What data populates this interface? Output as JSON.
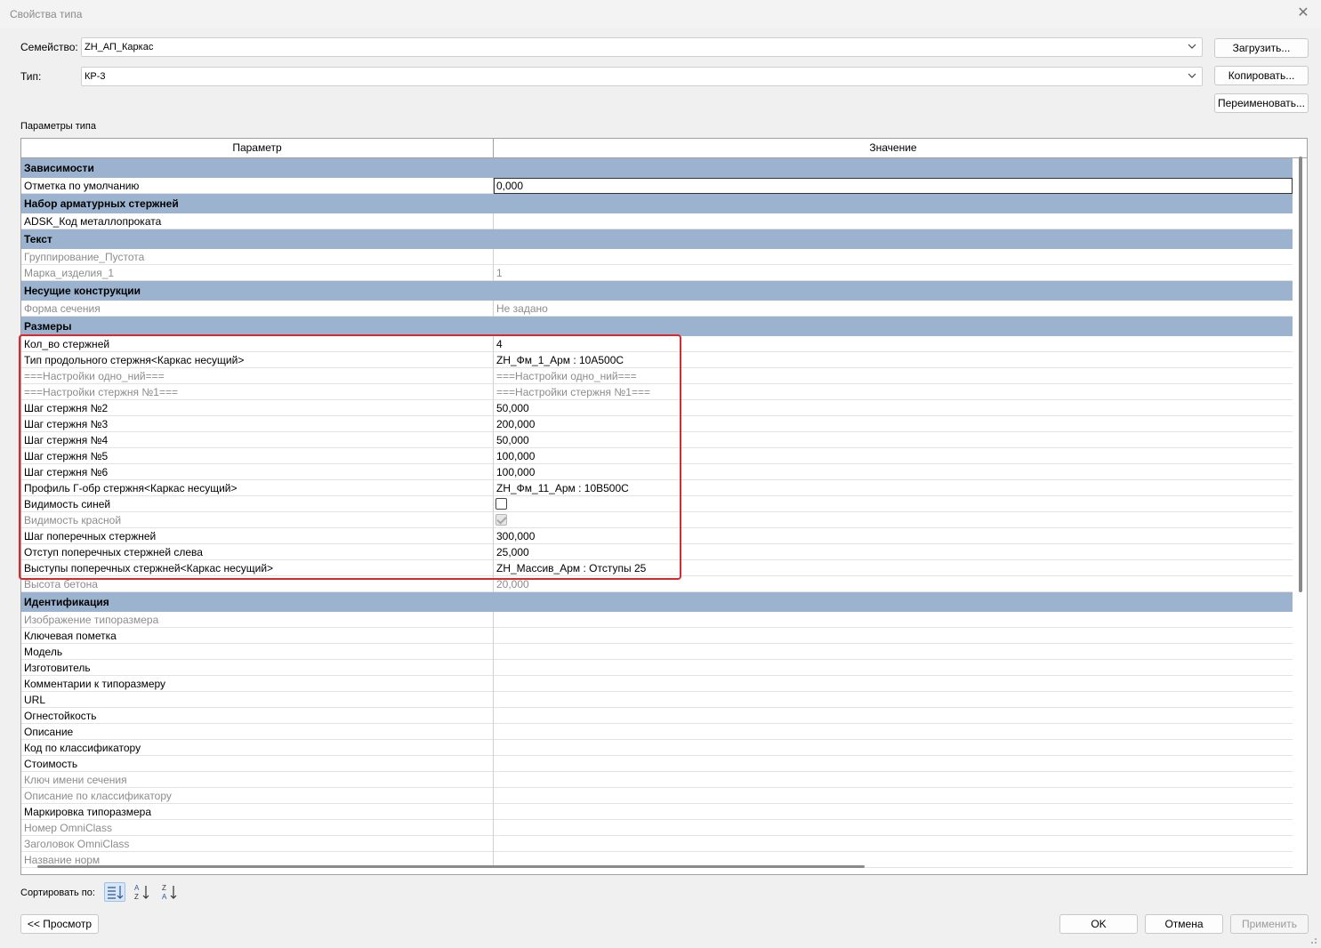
{
  "window": {
    "title": "Свойства типа"
  },
  "family": {
    "label": "Семейство:",
    "value": "ZH_АП_Каркас"
  },
  "type": {
    "label": "Тип:",
    "value": "КР-3"
  },
  "buttons": {
    "load": "Загрузить...",
    "copy": "Копировать...",
    "rename": "Переименовать...",
    "preview": "<< Просмотр",
    "ok": "OK",
    "cancel": "Отмена",
    "apply": "Применить"
  },
  "params_label": "Параметры типа",
  "table": {
    "col_param": "Параметр",
    "col_value": "Значение",
    "rows": [
      {
        "kind": "group",
        "label": "Зависимости"
      },
      {
        "kind": "row",
        "param": "Отметка по умолчанию",
        "value": "0,000",
        "editing": true
      },
      {
        "kind": "group",
        "label": "Набор арматурных стержней"
      },
      {
        "kind": "row",
        "param": "ADSK_Код металлопроката",
        "value": ""
      },
      {
        "kind": "group",
        "label": "Текст"
      },
      {
        "kind": "row",
        "param": "Группирование_Пустота",
        "value": "",
        "gray": true
      },
      {
        "kind": "row",
        "param": "Марка_изделия_1",
        "value": "1",
        "gray": true
      },
      {
        "kind": "group",
        "label": "Несущие конструкции"
      },
      {
        "kind": "row",
        "param": "Форма сечения",
        "value": "Не задано",
        "gray": true
      },
      {
        "kind": "group",
        "label": "Размеры"
      },
      {
        "kind": "row",
        "param": "Кол_во стержней",
        "value": "4"
      },
      {
        "kind": "row",
        "param": "Тип продольного стержня<Каркас несущий>",
        "value": "ZH_Фм_1_Арм : 10А500С"
      },
      {
        "kind": "row",
        "param": "===Настройки одно_ний===",
        "value": "===Настройки одно_ний===",
        "gray": true
      },
      {
        "kind": "row",
        "param": "===Настройки стержня №1===",
        "value": "===Настройки стержня №1===",
        "gray": true
      },
      {
        "kind": "row",
        "param": "Шаг стержня №2",
        "value": "50,000"
      },
      {
        "kind": "row",
        "param": "Шаг стержня №3",
        "value": "200,000"
      },
      {
        "kind": "row",
        "param": "Шаг стержня №4",
        "value": "50,000"
      },
      {
        "kind": "row",
        "param": "Шаг стержня №5",
        "value": "100,000"
      },
      {
        "kind": "row",
        "param": "Шаг стержня №6",
        "value": "100,000"
      },
      {
        "kind": "row",
        "param": "Профиль Г-обр стержня<Каркас несущий>",
        "value": "ZH_Фм_11_Арм : 10В500С"
      },
      {
        "kind": "row",
        "param": "Видимость синей",
        "checkbox": "unchecked"
      },
      {
        "kind": "row",
        "param": "Видимость красной",
        "checkbox": "checked-disabled",
        "gray": true
      },
      {
        "kind": "row",
        "param": "Шаг поперечных стержней",
        "value": "300,000"
      },
      {
        "kind": "row",
        "param": "Отступ поперечных стержней слева",
        "value": "25,000"
      },
      {
        "kind": "row",
        "param": "Выступы поперечных стержней<Каркас несущий>",
        "value": "ZH_Массив_Арм : Отступы 25"
      },
      {
        "kind": "row",
        "param": "Высота бетона",
        "value": "20,000",
        "gray": true
      },
      {
        "kind": "group",
        "label": "Идентификация"
      },
      {
        "kind": "row",
        "param": "Изображение типоразмера",
        "value": "",
        "gray": true
      },
      {
        "kind": "row",
        "param": "Ключевая пометка",
        "value": ""
      },
      {
        "kind": "row",
        "param": "Модель",
        "value": ""
      },
      {
        "kind": "row",
        "param": "Изготовитель",
        "value": ""
      },
      {
        "kind": "row",
        "param": "Комментарии к типоразмеру",
        "value": ""
      },
      {
        "kind": "row",
        "param": "URL",
        "value": ""
      },
      {
        "kind": "row",
        "param": "Огнестойкость",
        "value": ""
      },
      {
        "kind": "row",
        "param": "Описание",
        "value": ""
      },
      {
        "kind": "row",
        "param": "Код по классификатору",
        "value": ""
      },
      {
        "kind": "row",
        "param": "Стоимость",
        "value": ""
      },
      {
        "kind": "row",
        "param": "Ключ имени сечения",
        "value": "",
        "gray": true
      },
      {
        "kind": "row",
        "param": "Описание по классификатору",
        "value": "",
        "gray": true
      },
      {
        "kind": "row",
        "param": "Маркировка типоразмера",
        "value": ""
      },
      {
        "kind": "row",
        "param": "Номер OmniClass",
        "value": "",
        "gray": true
      },
      {
        "kind": "row",
        "param": "Заголовок OmniClass",
        "value": "",
        "gray": true
      },
      {
        "kind": "row",
        "param": "Название норм",
        "value": "",
        "gray": true
      }
    ]
  },
  "sort": {
    "label": "Сортировать по:",
    "icons": [
      "group-sort-icon",
      "sort-az-icon",
      "sort-za-icon"
    ],
    "active": "group-sort-icon"
  },
  "colors": {
    "group_header": "#9cb3cf",
    "highlight": "#d9282e"
  }
}
